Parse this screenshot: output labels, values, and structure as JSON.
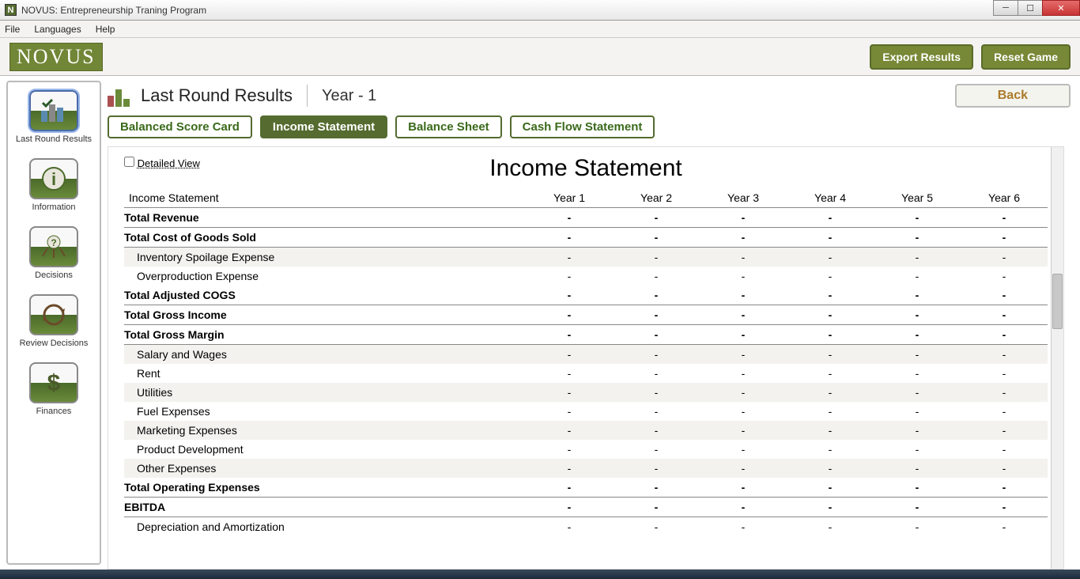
{
  "window": {
    "title": "NOVUS: Entrepreneurship Traning Program"
  },
  "menu": {
    "file": "File",
    "languages": "Languages",
    "help": "Help"
  },
  "brand": "NOVUS",
  "topButtons": {
    "export": "Export Results",
    "reset": "Reset Game"
  },
  "sidebar": [
    {
      "label": "Last Round Results",
      "icon": "bars-check"
    },
    {
      "label": "Information",
      "icon": "info"
    },
    {
      "label": "Decisions",
      "icon": "question-arrows"
    },
    {
      "label": "Review Decisions",
      "icon": "cycle"
    },
    {
      "label": "Finances",
      "icon": "dollar"
    }
  ],
  "page": {
    "title": "Last Round Results",
    "year": "Year - 1",
    "back": "Back"
  },
  "tabs": [
    {
      "label": "Balanced Score Card",
      "active": false
    },
    {
      "label": "Income Statement",
      "active": true
    },
    {
      "label": "Balance Sheet",
      "active": false
    },
    {
      "label": "Cash Flow Statement",
      "active": false
    }
  ],
  "sheet": {
    "detailedLabel": "Detailed View",
    "title": "Income Statement",
    "headerLabel": "Income Statement",
    "years": [
      "Year 1",
      "Year 2",
      "Year 3",
      "Year 4",
      "Year 5",
      "Year 6"
    ],
    "rows": [
      {
        "label": "Total Revenue",
        "bold": true,
        "vals": [
          "-",
          "-",
          "-",
          "-",
          "-",
          "-"
        ]
      },
      {
        "label": "Total Cost of Goods Sold",
        "bold": true,
        "vals": [
          "-",
          "-",
          "-",
          "-",
          "-",
          "-"
        ]
      },
      {
        "label": "Inventory Spoilage Expense",
        "bold": false,
        "stripe": true,
        "vals": [
          "-",
          "-",
          "-",
          "-",
          "-",
          "-"
        ]
      },
      {
        "label": "Overproduction Expense",
        "bold": false,
        "vals": [
          "-",
          "-",
          "-",
          "-",
          "-",
          "-"
        ]
      },
      {
        "label": "Total Adjusted COGS",
        "bold": true,
        "vals": [
          "-",
          "-",
          "-",
          "-",
          "-",
          "-"
        ]
      },
      {
        "label": "Total Gross Income",
        "bold": true,
        "vals": [
          "-",
          "-",
          "-",
          "-",
          "-",
          "-"
        ]
      },
      {
        "label": "Total Gross Margin",
        "bold": true,
        "vals": [
          "-",
          "-",
          "-",
          "-",
          "-",
          "-"
        ]
      },
      {
        "label": "Salary and Wages",
        "bold": false,
        "stripe": true,
        "vals": [
          "-",
          "-",
          "-",
          "-",
          "-",
          "-"
        ]
      },
      {
        "label": "Rent",
        "bold": false,
        "vals": [
          "-",
          "-",
          "-",
          "-",
          "-",
          "-"
        ]
      },
      {
        "label": "Utilities",
        "bold": false,
        "stripe": true,
        "vals": [
          "-",
          "-",
          "-",
          "-",
          "-",
          "-"
        ]
      },
      {
        "label": "Fuel Expenses",
        "bold": false,
        "vals": [
          "-",
          "-",
          "-",
          "-",
          "-",
          "-"
        ]
      },
      {
        "label": "Marketing Expenses",
        "bold": false,
        "stripe": true,
        "vals": [
          "-",
          "-",
          "-",
          "-",
          "-",
          "-"
        ]
      },
      {
        "label": "Product Development",
        "bold": false,
        "vals": [
          "-",
          "-",
          "-",
          "-",
          "-",
          "-"
        ]
      },
      {
        "label": "Other Expenses",
        "bold": false,
        "stripe": true,
        "vals": [
          "-",
          "-",
          "-",
          "-",
          "-",
          "-"
        ]
      },
      {
        "label": "Total Operating Expenses",
        "bold": true,
        "vals": [
          "-",
          "-",
          "-",
          "-",
          "-",
          "-"
        ]
      },
      {
        "label": "EBITDA",
        "bold": true,
        "vals": [
          "-",
          "-",
          "-",
          "-",
          "-",
          "-"
        ]
      },
      {
        "label": "Depreciation and Amortization",
        "bold": false,
        "vals": [
          "-",
          "-",
          "-",
          "-",
          "-",
          "-"
        ]
      }
    ]
  }
}
